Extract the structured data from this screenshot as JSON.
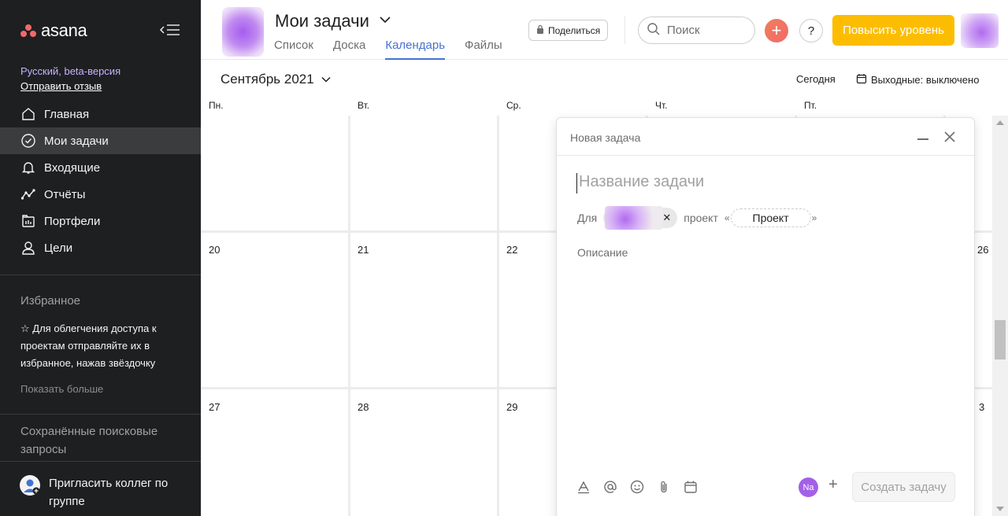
{
  "app": {
    "logo_text": "asana"
  },
  "sidebar": {
    "beta_label": "Русский, beta-версия",
    "feedback_link": "Отправить отзыв",
    "nav": [
      {
        "label": "Главная",
        "icon": "home-icon"
      },
      {
        "label": "Мои задачи",
        "icon": "check-circle-icon",
        "active": true
      },
      {
        "label": "Входящие",
        "icon": "bell-icon"
      },
      {
        "label": "Отчёты",
        "icon": "chart-line-icon"
      },
      {
        "label": "Портфели",
        "icon": "portfolio-icon"
      },
      {
        "label": "Цели",
        "icon": "goal-icon"
      }
    ],
    "favorites_title": "Избранное",
    "favorites_hint": "Для облегчения доступа к проектам отправляйте их в избранное, нажав звёздочку",
    "show_more": "Показать больше",
    "saved_searches_title": "Сохранённые поисковые запросы",
    "invite_label": "Пригласить коллег по группе"
  },
  "header": {
    "title": "Мои задачи",
    "tabs": [
      {
        "label": "Список"
      },
      {
        "label": "Доска"
      },
      {
        "label": "Календарь",
        "active": true
      },
      {
        "label": "Файлы"
      }
    ],
    "share_label": "Поделиться",
    "search_placeholder": "Поиск",
    "upgrade_label": "Повысить уровень",
    "help_label": "?"
  },
  "calendar": {
    "month_label": "Сентябрь 2021",
    "today_label": "Сегодня",
    "weekends_label": "Выходные: выключено",
    "day_headers": [
      "Пн.",
      "Вт.",
      "Ср.",
      "Чт.",
      "Пт."
    ],
    "week2_days": [
      "20",
      "21",
      "22",
      "26"
    ],
    "week3_days": [
      "27",
      "28",
      "29",
      "3"
    ]
  },
  "task_dialog": {
    "title": "Новая задача",
    "name_placeholder": "Название задачи",
    "for_label": "Для",
    "project_label": "проект",
    "project_placeholder": "Проект",
    "description_placeholder": "Описание",
    "collaborator_initials": "Na",
    "create_label": "Создать задачу"
  },
  "colors": {
    "sidebar_bg": "#1e1f21",
    "accent_blue": "#4573d2",
    "upgrade_yellow": "#fcbd01",
    "brand_coral": "#f06a6a",
    "collaborator_purple": "#a460e6"
  }
}
